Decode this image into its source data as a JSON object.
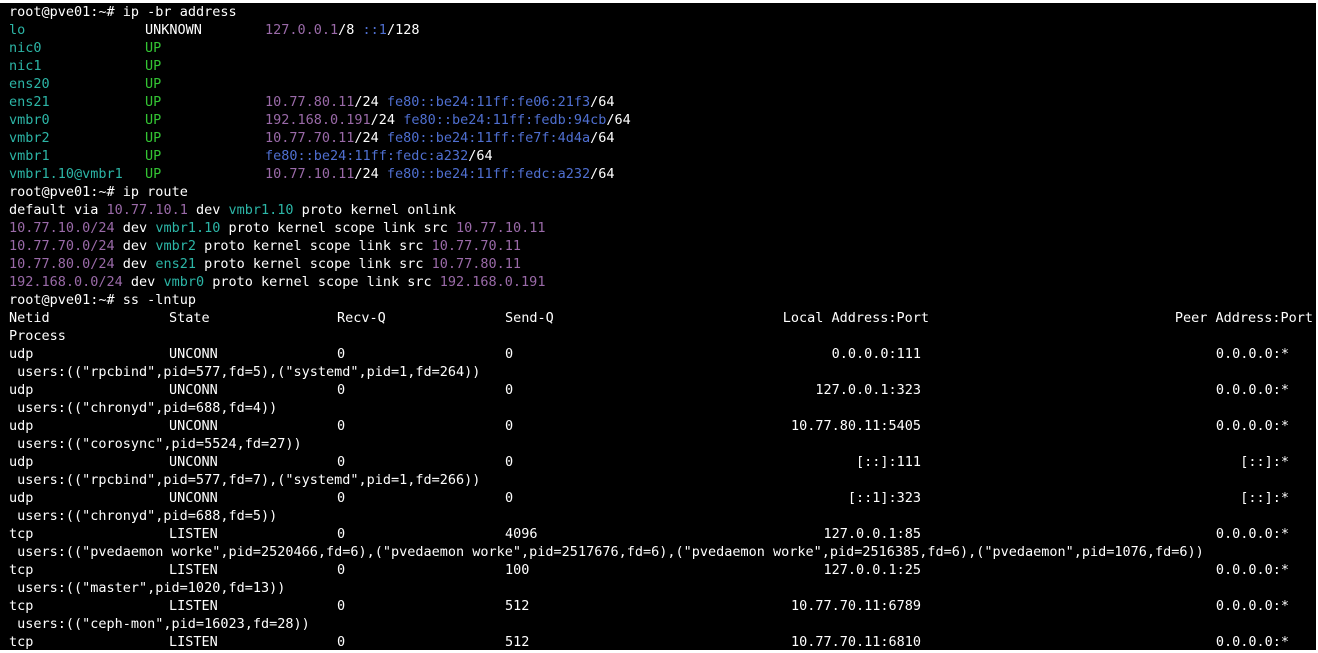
{
  "colors": {
    "background": "#000000",
    "text": "#ffffff",
    "interface": "#2cb5a6",
    "state_up": "#33c433",
    "ipv4": "#9a6aa8",
    "ipv6": "#4f6fd0"
  },
  "prompt": "root@pve01:~# ",
  "commands": {
    "ip_addr": "ip -br address",
    "ip_route": "ip route",
    "ss": "ss -lntup"
  },
  "ip_addr": [
    {
      "iface": "lo",
      "state": "UNKNOWN",
      "addrs": [
        [
          "ipv4",
          "127.0.0.1"
        ],
        [
          "def",
          "/8 "
        ],
        [
          "ipv6",
          "::1"
        ],
        [
          "def",
          "/128"
        ]
      ]
    },
    {
      "iface": "nic0",
      "state": "UP",
      "addrs": []
    },
    {
      "iface": "nic1",
      "state": "UP",
      "addrs": []
    },
    {
      "iface": "ens20",
      "state": "UP",
      "addrs": []
    },
    {
      "iface": "ens21",
      "state": "UP",
      "addrs": [
        [
          "ipv4",
          "10.77.80.11"
        ],
        [
          "def",
          "/24 "
        ],
        [
          "ipv6",
          "fe80::be24:11ff:fe06:21f3"
        ],
        [
          "def",
          "/64"
        ]
      ]
    },
    {
      "iface": "vmbr0",
      "state": "UP",
      "addrs": [
        [
          "ipv4",
          "192.168.0.191"
        ],
        [
          "def",
          "/24 "
        ],
        [
          "ipv6",
          "fe80::be24:11ff:fedb:94cb"
        ],
        [
          "def",
          "/64"
        ]
      ]
    },
    {
      "iface": "vmbr2",
      "state": "UP",
      "addrs": [
        [
          "ipv4",
          "10.77.70.11"
        ],
        [
          "def",
          "/24 "
        ],
        [
          "ipv6",
          "fe80::be24:11ff:fe7f:4d4a"
        ],
        [
          "def",
          "/64"
        ]
      ]
    },
    {
      "iface": "vmbr1",
      "state": "UP",
      "addrs": [
        [
          "ipv6",
          "fe80::be24:11ff:fedc:a232"
        ],
        [
          "def",
          "/64"
        ]
      ]
    },
    {
      "iface": "vmbr1.10@vmbr1",
      "state": "UP",
      "addrs": [
        [
          "ipv4",
          "10.77.10.11"
        ],
        [
          "def",
          "/24 "
        ],
        [
          "ipv6",
          "fe80::be24:11ff:fedc:a232"
        ],
        [
          "def",
          "/64"
        ]
      ]
    }
  ],
  "ip_route": [
    [
      [
        "def",
        "default via "
      ],
      [
        "ipv4",
        "10.77.10.1"
      ],
      [
        "def",
        " dev "
      ],
      [
        "dev",
        "vmbr1.10"
      ],
      [
        "def",
        " proto kernel onlink"
      ]
    ],
    [
      [
        "ipv4",
        "10.77.10.0/24"
      ],
      [
        "def",
        " dev "
      ],
      [
        "dev",
        "vmbr1.10"
      ],
      [
        "def",
        " proto kernel scope link src "
      ],
      [
        "ipv4",
        "10.77.10.11"
      ]
    ],
    [
      [
        "ipv4",
        "10.77.70.0/24"
      ],
      [
        "def",
        " dev "
      ],
      [
        "dev",
        "vmbr2"
      ],
      [
        "def",
        " proto kernel scope link src "
      ],
      [
        "ipv4",
        "10.77.70.11"
      ]
    ],
    [
      [
        "ipv4",
        "10.77.80.0/24"
      ],
      [
        "def",
        " dev "
      ],
      [
        "dev",
        "ens21"
      ],
      [
        "def",
        " proto kernel scope link src "
      ],
      [
        "ipv4",
        "10.77.80.11"
      ]
    ],
    [
      [
        "ipv4",
        "192.168.0.0/24"
      ],
      [
        "def",
        " dev "
      ],
      [
        "dev",
        "vmbr0"
      ],
      [
        "def",
        " proto kernel scope link src "
      ],
      [
        "ipv4",
        "192.168.0.191"
      ]
    ]
  ],
  "ss": {
    "headers": {
      "netid": "Netid",
      "state": "State",
      "recvq": "Recv-Q",
      "sendq": "Send-Q",
      "local": "Local Address:Port",
      "peer": "Peer Address:Port",
      "process": "Process"
    },
    "rows": [
      {
        "netid": "udp",
        "state": "UNCONN",
        "recvq": "0",
        "sendq": "0",
        "local": "0.0.0.0:111",
        "peer": "0.0.0.0:*",
        "process": " users:((\"rpcbind\",pid=577,fd=5),(\"systemd\",pid=1,fd=264))"
      },
      {
        "netid": "udp",
        "state": "UNCONN",
        "recvq": "0",
        "sendq": "0",
        "local": "127.0.0.1:323",
        "peer": "0.0.0.0:*",
        "process": " users:((\"chronyd\",pid=688,fd=4))"
      },
      {
        "netid": "udp",
        "state": "UNCONN",
        "recvq": "0",
        "sendq": "0",
        "local": "10.77.80.11:5405",
        "peer": "0.0.0.0:*",
        "process": " users:((\"corosync\",pid=5524,fd=27))"
      },
      {
        "netid": "udp",
        "state": "UNCONN",
        "recvq": "0",
        "sendq": "0",
        "local": "[::]:111",
        "peer": "[::]:*",
        "process": " users:((\"rpcbind\",pid=577,fd=7),(\"systemd\",pid=1,fd=266))"
      },
      {
        "netid": "udp",
        "state": "UNCONN",
        "recvq": "0",
        "sendq": "0",
        "local": "[::1]:323",
        "peer": "[::]:*",
        "process": " users:((\"chronyd\",pid=688,fd=5))"
      },
      {
        "netid": "tcp",
        "state": "LISTEN",
        "recvq": "0",
        "sendq": "4096",
        "local": "127.0.0.1:85",
        "peer": "0.0.0.0:*",
        "process": " users:((\"pvedaemon worke\",pid=2520466,fd=6),(\"pvedaemon worke\",pid=2517676,fd=6),(\"pvedaemon worke\",pid=2516385,fd=6),(\"pvedaemon\",pid=1076,fd=6))"
      },
      {
        "netid": "tcp",
        "state": "LISTEN",
        "recvq": "0",
        "sendq": "100",
        "local": "127.0.0.1:25",
        "peer": "0.0.0.0:*",
        "process": " users:((\"master\",pid=1020,fd=13))"
      },
      {
        "netid": "tcp",
        "state": "LISTEN",
        "recvq": "0",
        "sendq": "512",
        "local": "10.77.70.11:6789",
        "peer": "0.0.0.0:*",
        "process": " users:((\"ceph-mon\",pid=16023,fd=28))"
      },
      {
        "netid": "tcp",
        "state": "LISTEN",
        "recvq": "0",
        "sendq": "512",
        "local": "10.77.70.11:6810",
        "peer": "0.0.0.0:*",
        "process": ""
      }
    ]
  }
}
